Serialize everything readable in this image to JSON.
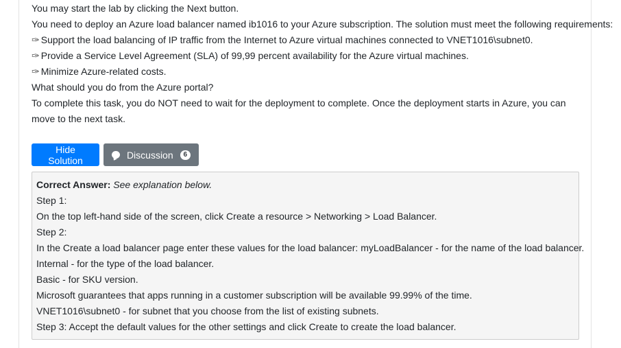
{
  "question": {
    "lines": [
      "You may start the lab by clicking the Next button.",
      "You need to deploy an Azure load balancer named ib1016 to your Azure subscription. The solution must meet the following requirements:",
      "Support the load balancing of IP traffic from the Internet to Azure virtual machines connected to VNET1016\\subnet0.",
      "Provide a Service Level Agreement (SLA) of 99,99 percent availability for the Azure virtual machines.",
      "Minimize Azure-related costs.",
      "What should you do from the Azure portal?",
      "To complete this task, you do NOT need to wait for the deployment to complete. Once the deployment starts in Azure, you can move to the next task."
    ],
    "bullet_glyph": "✑"
  },
  "buttons": {
    "hide_solution": "Hide Solution",
    "discussion": "Discussion",
    "discussion_count": "6"
  },
  "solution": {
    "correct_answer_label": "Correct Answer:",
    "correct_answer_note": "See explanation below.",
    "lines": [
      "Step 1:",
      "On the top left-hand side of the screen, click Create a resource > Networking > Load Balancer.",
      "Step 2:",
      "In the Create a load balancer page enter these values for the load balancer: myLoadBalancer - for the name of the load balancer.",
      "Internal - for the type of the load balancer.",
      "Basic - for SKU version.",
      "Microsoft guarantees that apps running in a customer subscription will be available 99.99% of the time.",
      "VNET1016\\subnet0 - for subnet that you choose from the list of existing subnets.",
      "Step 3: Accept the default values for the other settings and click Create to create the load balancer."
    ]
  }
}
